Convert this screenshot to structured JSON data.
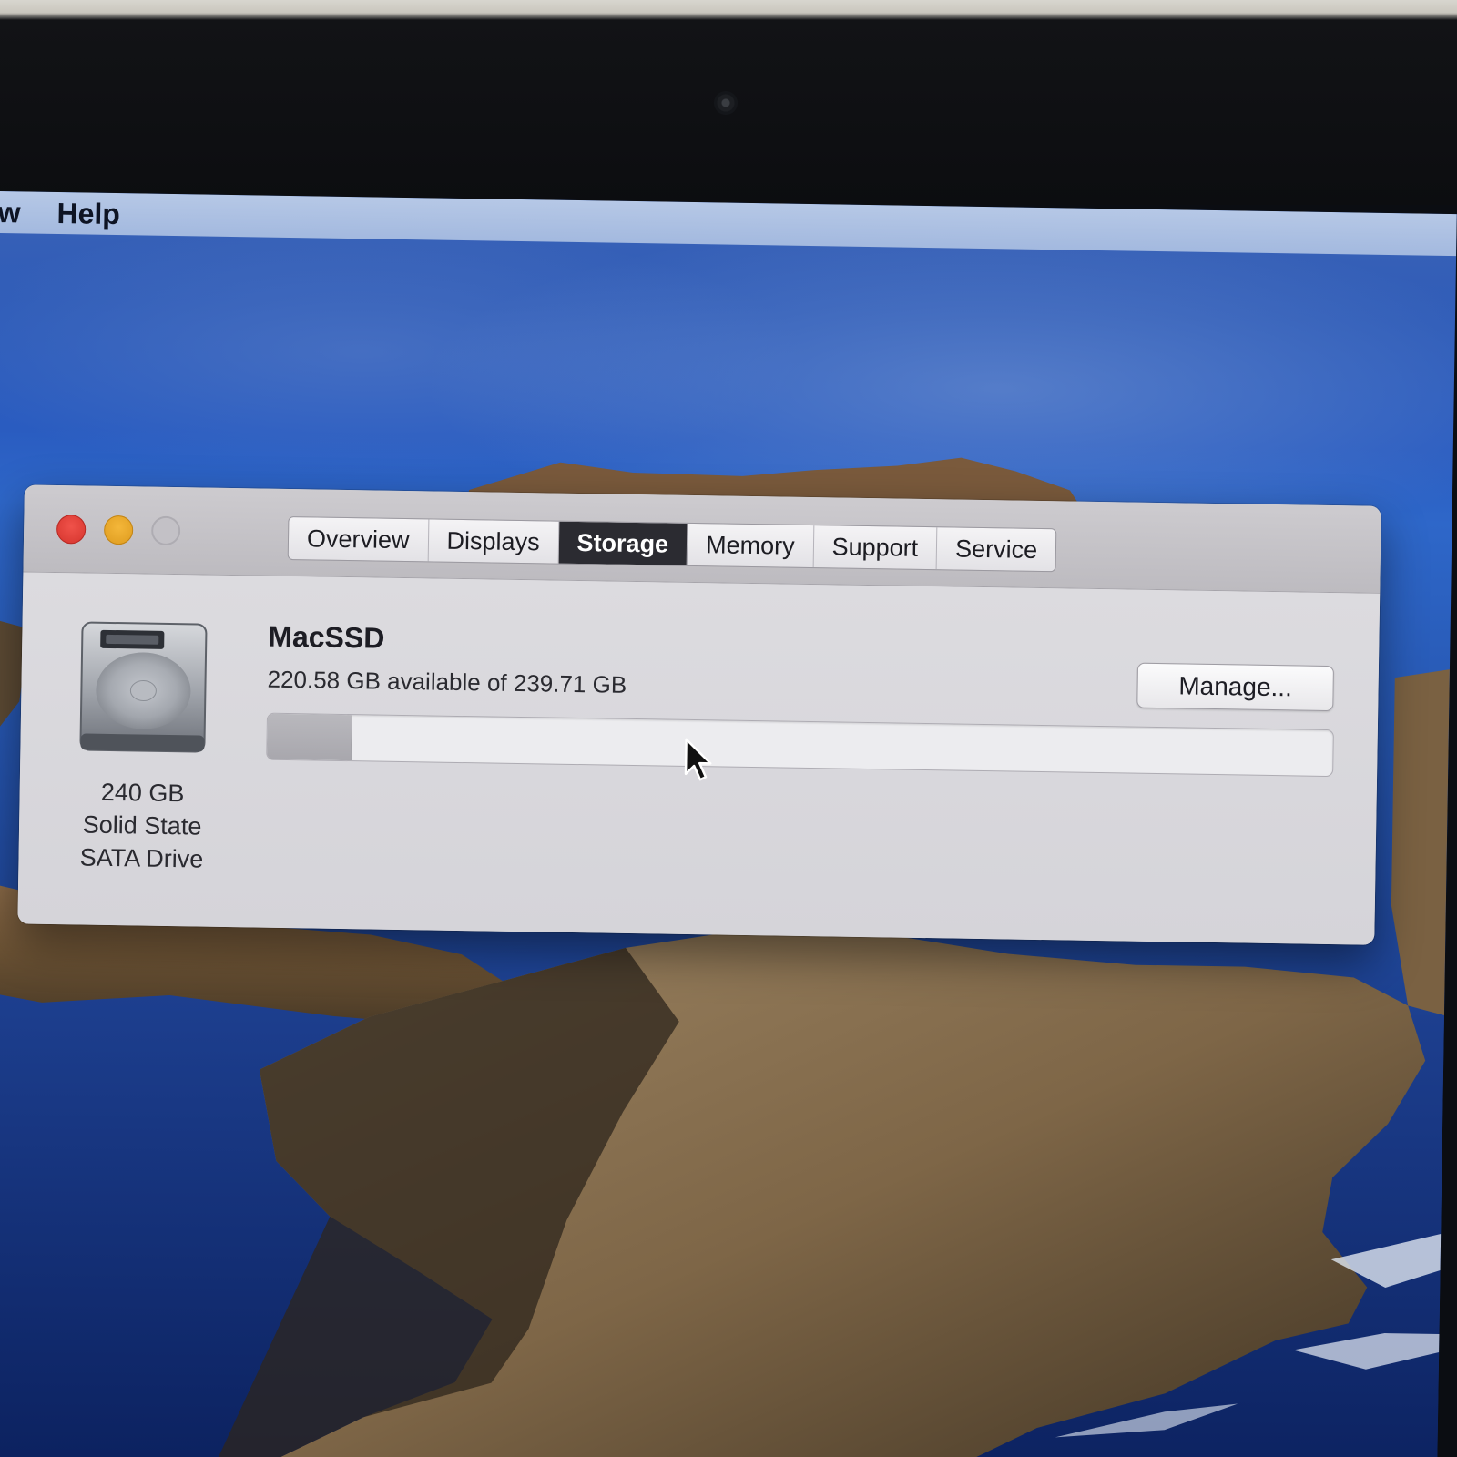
{
  "menubar": {
    "items": [
      "w",
      "Help"
    ]
  },
  "window": {
    "tabs": [
      {
        "label": "Overview",
        "active": false
      },
      {
        "label": "Displays",
        "active": false
      },
      {
        "label": "Storage",
        "active": true
      },
      {
        "label": "Memory",
        "active": false
      },
      {
        "label": "Support",
        "active": false
      },
      {
        "label": "Service",
        "active": false
      }
    ],
    "drive": {
      "icon": "hard-drive-icon",
      "caption": [
        "240 GB",
        "Solid State",
        "SATA Drive"
      ]
    },
    "volume": {
      "name": "MacSSD",
      "availability": "220.58 GB available of 239.71 GB",
      "available_gb": 220.58,
      "total_gb": 239.71
    },
    "manage_label": "Manage..."
  },
  "colors": {
    "close": "#ec4a42",
    "minimize": "#f0ad30",
    "active_tab": "#2b2b31"
  }
}
